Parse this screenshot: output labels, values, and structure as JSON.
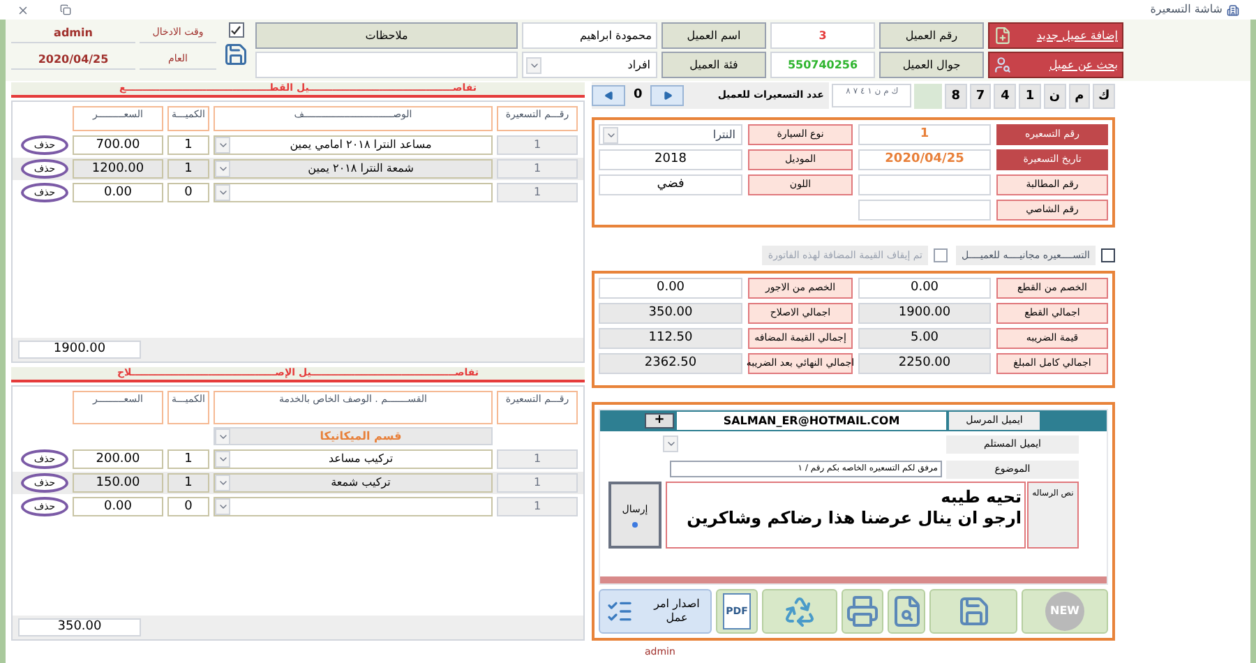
{
  "window": {
    "title": "شاشة التسعيرة"
  },
  "session": [
    {
      "label": "وقت الادخال",
      "value": "admin"
    },
    {
      "label": "العام",
      "value": "2020/04/25"
    }
  ],
  "notes": {
    "label": "ملاحظات",
    "checked": true
  },
  "customer": {
    "name": "محمودة ابراهيم",
    "category": "افراد",
    "name_label": "اسم العميل",
    "number_label": "رقم العميل",
    "number": "3",
    "category_label": "فئة العميل",
    "mobile_label": "جوال العميل",
    "mobile": "550740256"
  },
  "customer_actions": [
    {
      "kind": "add",
      "label": "إضافة عميل جديد"
    },
    {
      "kind": "search",
      "label": "بحث عن عميل"
    }
  ],
  "plate": {
    "characters": [
      "ك",
      "م",
      "ن",
      "1",
      "4",
      "7",
      "8"
    ],
    "text": "ك م ن ١ ٤ ٧ ٨"
  },
  "pricing_count": {
    "label": "عدد التسعيرات للعميل",
    "value": "0"
  },
  "pricing_info": [
    {
      "kind": "highlight",
      "label": "رقم التسعيره",
      "value": "1"
    },
    {
      "kind": "select",
      "label": "نوع السيارة",
      "value": "النترا"
    },
    {
      "kind": "highlight",
      "label": "تاريخ التسعيرة",
      "value": "2020/04/25"
    },
    {
      "kind": "plain",
      "label": "الموديل",
      "value": "2018"
    },
    {
      "kind": "plain",
      "label": "رقم المطالبة"
    },
    {
      "kind": "plain",
      "label": "اللون",
      "value": "فضي"
    },
    {
      "kind": "plain",
      "label": "رقم الشاصي"
    }
  ],
  "options": [
    {
      "label": "التســــعيره مجانيــــه للعميــــل",
      "checked": false,
      "disabled": false
    },
    {
      "label": "تم إيقاف القيمة المضافة لهذه الفاتورة",
      "checked": false,
      "disabled": true
    }
  ],
  "totals": [
    {
      "label": "الخصم من القطع",
      "value": "0.00",
      "readonly": false
    },
    {
      "label": "الخصم من الاجور",
      "value": "0.00",
      "readonly": false
    },
    {
      "label": "اجمالي القطع",
      "value": "1900.00",
      "readonly": true
    },
    {
      "label": "اجمالي الاصلاح",
      "value": "350.00",
      "readonly": true
    },
    {
      "label": "قيمة الضريبه",
      "value": "5.00",
      "readonly": true
    },
    {
      "label": "إجمالي القيمة المضافه",
      "value": "112.50",
      "readonly": true
    },
    {
      "label": "اجمالي كامل المبلغ",
      "value": "2250.00",
      "readonly": true
    },
    {
      "label": "اجمالي النهائي بعد الضريبه",
      "value": "2362.50",
      "readonly": true
    }
  ],
  "parts": {
    "title": "تفاصـــــــــــــــــــــــــــــــــــــــــــيل القطـــــــــــــــــــــــــــــــــــــــــــع",
    "columns": [
      "رقـــم التسعيرة",
      "الوصـــــــــــــــــــــــــــــــف",
      "الكميـــة",
      "السعـــــــــر"
    ],
    "rows": [
      {
        "number": "1",
        "description": "مساعد النترا ٢٠١٨ امامي يمين",
        "quantity": "1",
        "price": "700.00",
        "selected": false,
        "action": "حذف"
      },
      {
        "number": "1",
        "description": "شمعة النترا ٢٠١٨ يمين",
        "quantity": "1",
        "price": "1200.00",
        "selected": true,
        "action": "حذف"
      },
      {
        "number": "1",
        "quantity": "0",
        "price": "0.00",
        "selected": false,
        "action": "حذف"
      }
    ],
    "total": "1900.00"
  },
  "repairs": {
    "title": "تفاصـــــــــــــــــــــــــــــــــــــــــــيل الإصـــــــــــــــــــــــــــــــــــــــــــلاح",
    "columns": [
      "رقـــم التسعيرة",
      "القســـــــم . الوصف الخاص بالخدمة",
      "الكميـــة",
      "السعـــــــــر"
    ],
    "category": "قسم الميكانيكا",
    "rows": [
      {
        "number": "1",
        "description": "تركيب مساعد",
        "quantity": "1",
        "price": "200.00",
        "selected": false,
        "action": "حذف"
      },
      {
        "number": "1",
        "description": "تركيب شمعة",
        "quantity": "1",
        "price": "150.00",
        "selected": true,
        "action": "حذف"
      },
      {
        "number": "1",
        "quantity": "0",
        "price": "0.00",
        "selected": false,
        "action": "حذف"
      }
    ],
    "total": "350.00"
  },
  "email": {
    "sender_label": "ايميل المرسل",
    "sender": "SALMAN_ER@HOTMAIL.COM",
    "add_button": "+",
    "recipient_label": "ايميل المستلم",
    "subject_label": "الموضوع",
    "subject": "مرفق لكم التسعيره الخاصه بكم رقم / ١",
    "message_label": "نص الرساله",
    "message": [
      "تحيه طيبه",
      "ارجو ان ينال عرضنا هذا رضاكم وشاكرين"
    ],
    "send_button": "إرسال"
  },
  "toolbar": [
    {
      "kind": "new",
      "label": "NEW"
    },
    {
      "kind": "save"
    },
    {
      "kind": "preview"
    },
    {
      "kind": "print"
    },
    {
      "kind": "delete"
    },
    {
      "kind": "pdf",
      "label": "PDF"
    },
    {
      "kind": "work_order",
      "label": "اصدار امر عمل"
    }
  ],
  "status_user": "admin"
}
